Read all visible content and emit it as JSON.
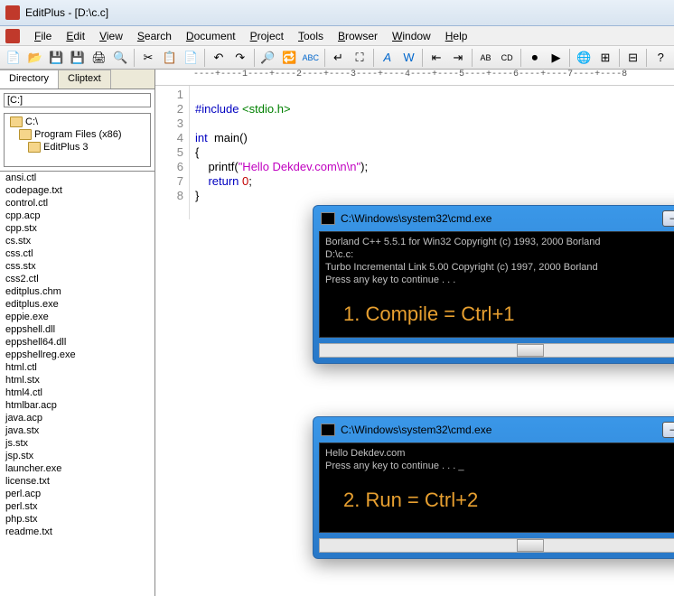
{
  "app": {
    "title": "EditPlus - [D:\\c.c]"
  },
  "menu": {
    "file": "File",
    "edit": "Edit",
    "view": "View",
    "search": "Search",
    "document": "Document",
    "project": "Project",
    "tools": "Tools",
    "browser": "Browser",
    "window": "Window",
    "help": "Help"
  },
  "sidebar": {
    "tab_directory": "Directory",
    "tab_cliptext": "Cliptext",
    "drive": "[C:]",
    "folders": [
      "C:\\",
      "Program Files (x86)",
      "EditPlus 3"
    ],
    "files": [
      "ansi.ctl",
      "codepage.txt",
      "control.ctl",
      "cpp.acp",
      "cpp.stx",
      "cs.stx",
      "css.ctl",
      "css.stx",
      "css2.ctl",
      "editplus.chm",
      "editplus.exe",
      "eppie.exe",
      "eppshell.dll",
      "eppshell64.dll",
      "eppshellreg.exe",
      "html.ctl",
      "html.stx",
      "html4.ctl",
      "htmlbar.acp",
      "java.acp",
      "java.stx",
      "js.stx",
      "jsp.stx",
      "launcher.exe",
      "license.txt",
      "perl.acp",
      "perl.stx",
      "php.stx",
      "readme.txt"
    ]
  },
  "ruler": "----+----1----+----2----+----3----+----4----+----5----+----6----+----7----+----8",
  "code": {
    "lines": [
      "1",
      "2",
      "3",
      "4",
      "5",
      "6",
      "7",
      "8"
    ],
    "l1_a": "#include",
    "l1_b": " <stdio.h>",
    "l3_a": "int",
    "l3_b": "  main()",
    "l4": "{",
    "l5_a": "    printf(",
    "l5_b": "\"Hello Dekdev.com\\n\\n\"",
    "l5_c": ");",
    "l6_a": "    ",
    "l6_b": "return",
    "l6_c": " ",
    "l6_d": "0",
    "l6_e": ";",
    "l7": "}"
  },
  "cmd1": {
    "title": "C:\\Windows\\system32\\cmd.exe",
    "lines": [
      "Borland C++ 5.5.1 for Win32 Copyright (c) 1993, 2000 Borland",
      "D:\\c.c:",
      "Turbo Incremental Link 5.00 Copyright (c) 1997, 2000 Borland",
      "Press any key to continue . . ."
    ],
    "annotation": "1. Compile = Ctrl+1"
  },
  "cmd2": {
    "title": "C:\\Windows\\system32\\cmd.exe",
    "lines": [
      "Hello Dekdev.com",
      "",
      "Press any key to continue . . . _"
    ],
    "annotation": "2. Run = Ctrl+2"
  }
}
